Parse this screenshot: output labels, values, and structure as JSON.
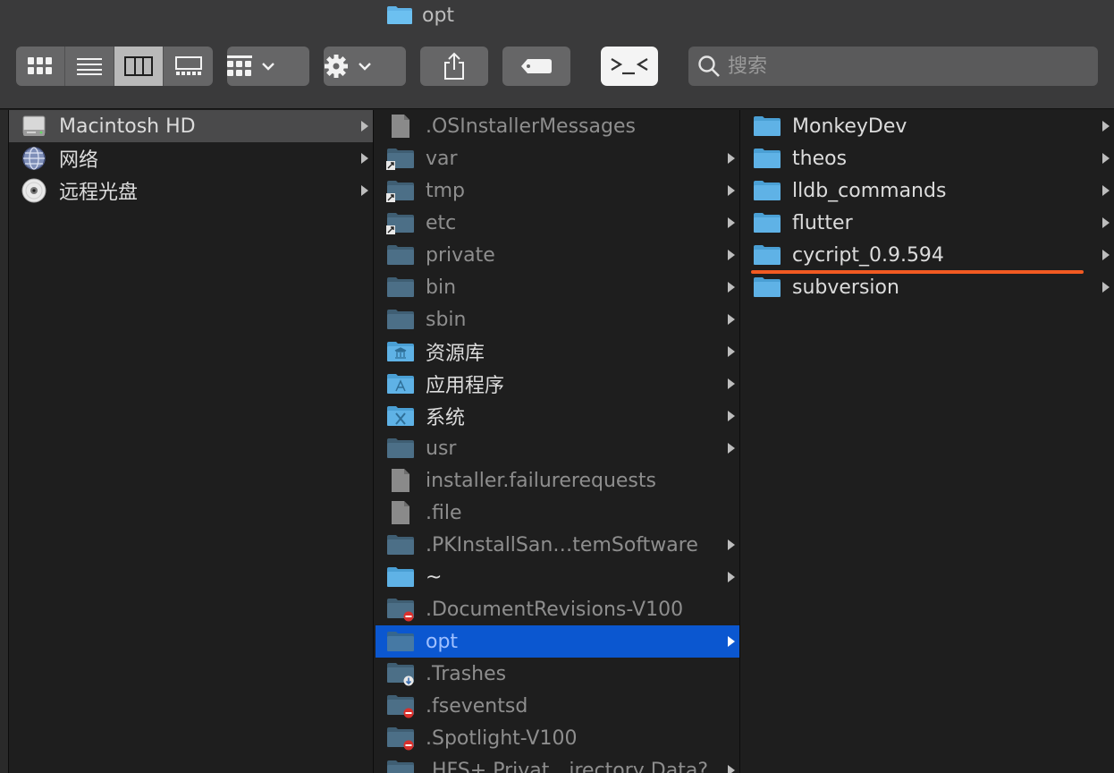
{
  "window": {
    "title": "opt"
  },
  "toolbar": {
    "views": [
      {
        "name": "icon-view",
        "active": false
      },
      {
        "name": "list-view",
        "active": false
      },
      {
        "name": "column-view",
        "active": true
      },
      {
        "name": "gallery-view",
        "active": false
      }
    ],
    "search_placeholder": "搜索"
  },
  "colors": {
    "selection": "#0b57d0",
    "folder_blue": "#5fb2e6",
    "folder_dim": "#4c6f87",
    "annotation_line": "#f25a22"
  },
  "col1": [
    {
      "label": "Macintosh HD",
      "icon": "hard-drive-icon"
    },
    {
      "label": "网络",
      "icon": "network-globe-icon"
    },
    {
      "label": "远程光盘",
      "icon": "optical-disc-icon"
    }
  ],
  "col2": [
    {
      "label": ".OSInstallerMessages",
      "icon": "file-icon"
    },
    {
      "label": "var",
      "icon": "alias-folder-icon"
    },
    {
      "label": "tmp",
      "icon": "alias-folder-icon"
    },
    {
      "label": "etc",
      "icon": "alias-folder-icon"
    },
    {
      "label": "private",
      "icon": "folder-icon"
    },
    {
      "label": "bin",
      "icon": "folder-icon"
    },
    {
      "label": "sbin",
      "icon": "folder-icon"
    },
    {
      "label": "资源库",
      "icon": "library-folder-icon"
    },
    {
      "label": "应用程序",
      "icon": "applications-folder-icon"
    },
    {
      "label": "系统",
      "icon": "system-folder-icon"
    },
    {
      "label": "usr",
      "icon": "folder-icon"
    },
    {
      "label": "installer.failurerequests",
      "icon": "file-icon"
    },
    {
      "label": ".file",
      "icon": "file-icon"
    },
    {
      "label": ".PKInstallSan…temSoftware",
      "icon": "folder-icon"
    },
    {
      "label": "~",
      "icon": "folder-icon"
    },
    {
      "label": ".DocumentRevisions-V100",
      "icon": "restricted-folder-icon"
    },
    {
      "label": "opt",
      "icon": "folder-icon"
    },
    {
      "label": ".Trashes",
      "icon": "dropbox-folder-icon"
    },
    {
      "label": ".fseventsd",
      "icon": "restricted-folder-icon"
    },
    {
      "label": ".Spotlight-V100",
      "icon": "restricted-folder-icon"
    },
    {
      "label": ".HFS+ Privat…irectory Data?",
      "icon": "folder-icon"
    }
  ],
  "col3": [
    {
      "label": "MonkeyDev",
      "icon": "folder-icon"
    },
    {
      "label": "theos",
      "icon": "folder-icon"
    },
    {
      "label": "lldb_commands",
      "icon": "folder-icon"
    },
    {
      "label": "flutter",
      "icon": "folder-icon"
    },
    {
      "label": "cycript_0.9.594",
      "icon": "folder-icon"
    },
    {
      "label": "subversion",
      "icon": "folder-icon"
    }
  ]
}
